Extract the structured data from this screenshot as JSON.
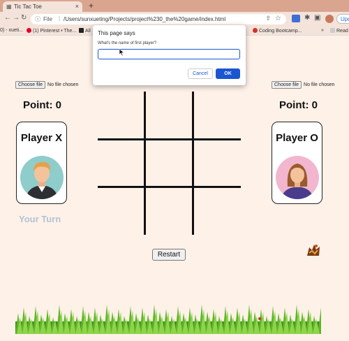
{
  "browser": {
    "tab_title": "Tic Tac Toe",
    "new_tab": "+",
    "url_prefix": "File",
    "url": "/Users/sunxueting/Projects/project%230_the%20game/index.html",
    "update_label": "Upd",
    "bookmarks": [
      {
        "label": "0) - xueti...",
        "color": "#888888"
      },
      {
        "label": "(1) Pinterest • The...",
        "color": "#e60023"
      },
      {
        "label": "All",
        "color": "#222222"
      },
      {
        "label": "Coding Bootcamp...",
        "color": "#d93025"
      },
      {
        "label": "Read",
        "color": "#666666"
      }
    ]
  },
  "dialog": {
    "title": "This page says",
    "message": "What's the name of first player?",
    "input_value": "",
    "cancel_label": "Cancel",
    "ok_label": "OK",
    "accent": "#1a73e8"
  },
  "game": {
    "file_button_label": "Choose file",
    "file_status": "No file chosen",
    "player_x": {
      "point_label": "Point: 0",
      "name": "Player X",
      "avatar_bg": "#8fcccc"
    },
    "player_o": {
      "point_label": "Point: 0",
      "name": "Player O",
      "avatar_bg": "#f2b6cf"
    },
    "turn_label": "Your Turn",
    "turn_color": "#b2c4d5",
    "restart_label": "Restart",
    "board_cells": [
      "",
      "",
      "",
      "",
      "",
      "",
      "",
      "",
      ""
    ]
  }
}
